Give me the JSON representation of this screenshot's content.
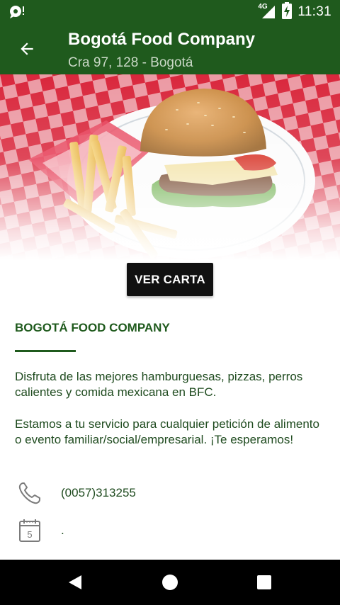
{
  "status_bar": {
    "time": "11:31",
    "network_label": "4G",
    "icons": [
      "notification-icon",
      "signal-icon",
      "battery-icon"
    ]
  },
  "app_bar": {
    "title": "Bogotá Food Company",
    "subtitle": "Cra 97, 128 - Bogotá",
    "back_icon": "arrow-left-icon"
  },
  "hero": {
    "alt": "burger-with-fries-image"
  },
  "menu_button": {
    "label": "VER CARTA"
  },
  "about": {
    "title": "BOGOTÁ FOOD COMPANY",
    "paragraph_1": "Disfruta de las mejores hamburguesas, pizzas, perros calientes y comida mexicana en BFC.",
    "paragraph_2": "Estamos a tu servicio para cualquier petición de alimento o evento familiar/social/empresarial. ¡Te esperamos!"
  },
  "contact": {
    "phone": "(0057)313255",
    "schedule": ".",
    "calendar_day": "5"
  },
  "nav_bar": {
    "back_icon": "triangle-back-icon",
    "home_icon": "circle-home-icon",
    "recents_icon": "square-recents-icon"
  },
  "colors": {
    "primary": "#1f5a1d",
    "text": "#1f4b1f",
    "button": "#111111"
  }
}
